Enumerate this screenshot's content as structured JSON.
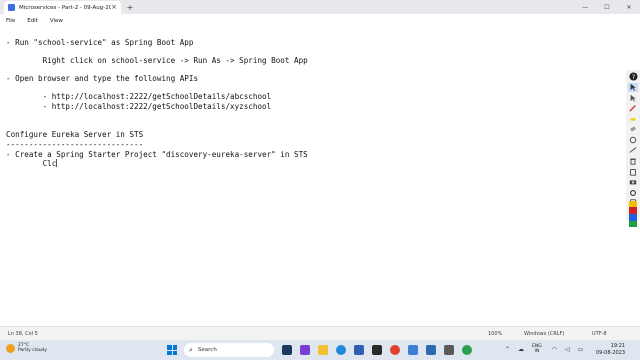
{
  "tab": {
    "title": "Microservices - Part-2 - 09-Aug-20",
    "close": "×",
    "new_tab": "+"
  },
  "window": {
    "minimize": "—",
    "maximize": "☐",
    "close": "✕"
  },
  "menu": [
    "File",
    "Edit",
    "View"
  ],
  "editor": {
    "lines": [
      "- Run \"school-service\" as Spring Boot App",
      "        Right click on school-service -> Run As -> Spring Boot App",
      "- Open browser and type the following APIs",
      "        - http://localhost:2222/getSchoolDetails/abcschool",
      "        - http://localhost:2222/getSchoolDetails/xyzschool",
      "Configure Eureka Server in STS",
      "------------------------------",
      "- Create a Spring Starter Project \"discovery-eureka-server\" in STS",
      "        Clc"
    ]
  },
  "status": {
    "position": "Ln 38, Col 5",
    "zoom": "100%",
    "line_ending": "Windows (CRLF)",
    "encoding": "UTF-8"
  },
  "taskbar": {
    "weather_temp": "27°C",
    "weather_desc": "Partly cloudy",
    "search_label": "Search",
    "lang_1": "ENG",
    "lang_2": "IN",
    "time": "19:21",
    "date": "09-08-2023"
  },
  "colors": {
    "accent": "#0078d4",
    "toolbar_selected": "#c9ddf6"
  }
}
